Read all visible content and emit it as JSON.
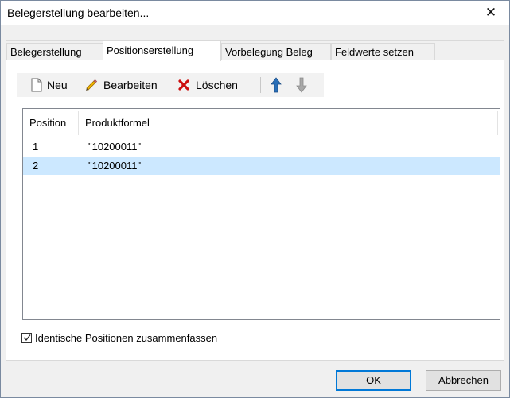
{
  "window": {
    "title": "Belegerstellung bearbeiten...",
    "close_glyph": "✕"
  },
  "tabs": [
    {
      "label": "Belegerstellung",
      "active": false
    },
    {
      "label": "Positionserstellung",
      "active": true
    },
    {
      "label": "Vorbelegung Beleg",
      "active": false
    },
    {
      "label": "Feldwerte setzen",
      "active": false
    }
  ],
  "toolbar": {
    "new_label": "Neu",
    "new_icon": "new-document-icon",
    "edit_label": "Bearbeiten",
    "edit_icon": "pencil-icon",
    "delete_label": "Löschen",
    "delete_icon": "red-x-icon",
    "move_up_icon": "arrow-up-icon",
    "move_down_icon": "arrow-down-icon"
  },
  "grid": {
    "columns": [
      "Position",
      "Produktformel"
    ],
    "rows": [
      {
        "position": "1",
        "formula": "\"10200011\"",
        "selected": false
      },
      {
        "position": "2",
        "formula": "\"10200011\"",
        "selected": true
      }
    ]
  },
  "options": {
    "merge_identical_label": "Identische Positionen zusammenfassen",
    "merge_identical_checked": true
  },
  "buttons": {
    "ok_label": "OK",
    "cancel_label": "Abbrechen"
  },
  "colors": {
    "selection": "#cce8ff",
    "delete_red": "#cc1010",
    "arrow_blue": "#2a6fb8",
    "pencil_yellow": "#f0b400"
  }
}
